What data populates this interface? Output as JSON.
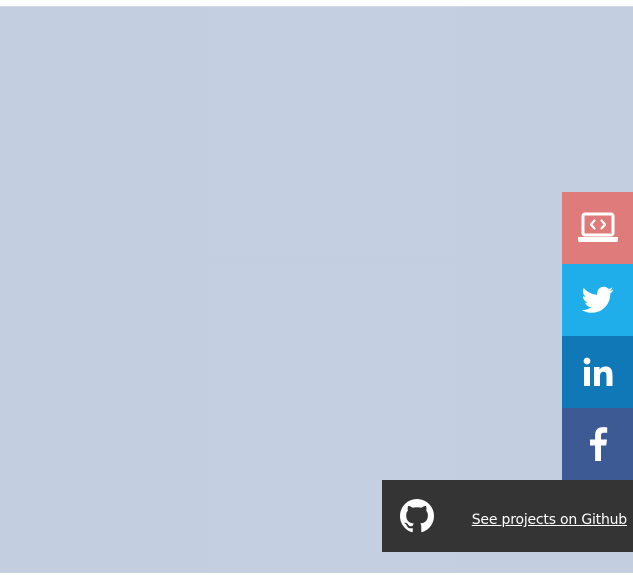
{
  "colors": {
    "background": "#c3cee1",
    "portfolio": "#e07b7b",
    "twitter": "#1faeea",
    "linkedin": "#1078b6",
    "facebook": "#3e5a95",
    "github_bar": "#343434"
  },
  "social_rail": {
    "items": [
      {
        "name": "portfolio",
        "icon": "laptop-code-icon"
      },
      {
        "name": "twitter",
        "icon": "twitter-icon"
      },
      {
        "name": "linkedin",
        "icon": "linkedin-icon"
      },
      {
        "name": "facebook",
        "icon": "facebook-icon"
      }
    ]
  },
  "github": {
    "icon": "github-icon",
    "link_label": "See projects on Github"
  }
}
